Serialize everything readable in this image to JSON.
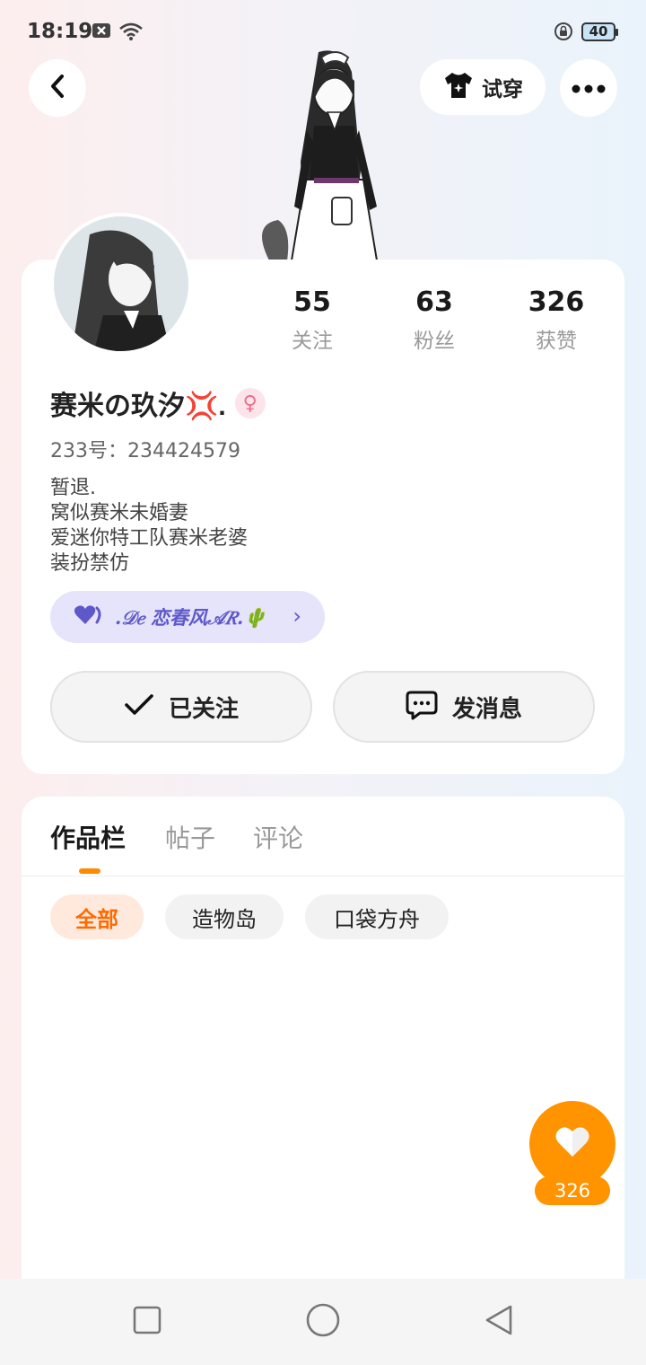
{
  "status_bar": {
    "time": "18:19",
    "battery": "40"
  },
  "header": {
    "back_icon": "chevron-left-icon",
    "try_on_label": "试穿",
    "more_icon": "more-dots-icon"
  },
  "profile": {
    "stats": [
      {
        "value": "55",
        "label": "关注"
      },
      {
        "value": "63",
        "label": "粉丝"
      },
      {
        "value": "326",
        "label": "获赞"
      }
    ],
    "nickname": "赛米の玖汐💢.",
    "gender_symbol": "♀",
    "uid": "233号：234424579",
    "bio": [
      "暂退.",
      "窝似赛米未婚妻",
      "爱迷你特工队赛米老婆",
      "装扮禁仿"
    ],
    "guild": {
      "name": ".𝒟𝑒 恋春风𝒜𝑅.🌵",
      "chevron": "›"
    },
    "follow_label": "已关注",
    "message_label": "发消息"
  },
  "works": {
    "tabs": [
      "作品栏",
      "帖子",
      "评论"
    ],
    "active_tab": "作品栏",
    "filters": [
      "全部",
      "造物岛",
      "口袋方舟"
    ],
    "active_filter": "全部"
  },
  "like_button": {
    "count": "326"
  },
  "colors": {
    "accent": "#ff9300",
    "chip_active_text": "#ff6a00",
    "guild_text": "#5f58c9",
    "guild_bg": "#e5e4fb"
  }
}
